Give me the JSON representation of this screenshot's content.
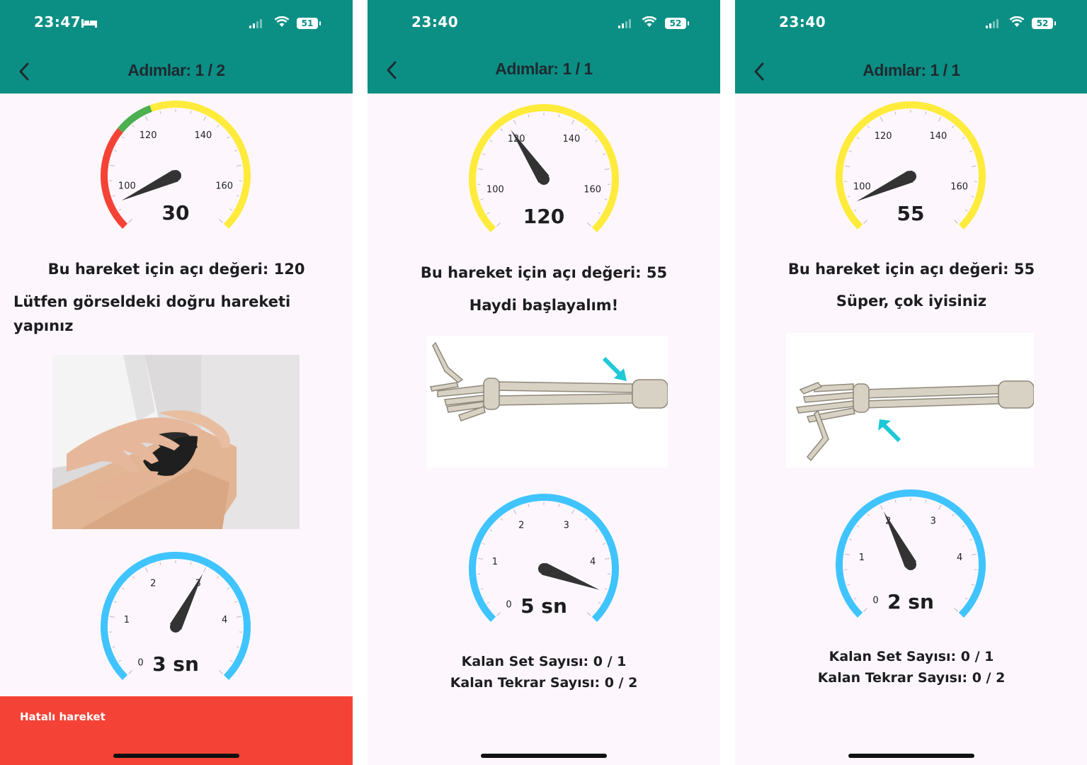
{
  "colors": {
    "header": "#0b8f85",
    "gauge_yellow": "#ffeb3b",
    "gauge_red": "#f44336",
    "gauge_green": "#4caf50",
    "timer_blue": "#40c4ff",
    "needle": "#333333",
    "toast": "#f44336"
  },
  "angle_gauge": {
    "min": 90,
    "max": 170,
    "labels": [
      "100",
      "120",
      "140",
      "160"
    ]
  },
  "timer_gauge": {
    "min": 0,
    "max": 5,
    "labels": [
      "0",
      "1",
      "2",
      "3",
      "4"
    ]
  },
  "screens": [
    {
      "status": {
        "time": "23:47",
        "battery": "51",
        "sleep_icon": "bed-icon"
      },
      "header": {
        "back_icon": "chevron-left-icon",
        "title": "Adımlar: 1 / 2"
      },
      "angle": {
        "value_label": "30",
        "needle_value": 96,
        "zones": [
          [
            "red",
            90,
            115
          ],
          [
            "green",
            115,
            124
          ],
          [
            "yellow",
            124,
            170
          ]
        ]
      },
      "angle_text": "Bu hareket için açı değeri: 120",
      "message": "Lütfen görseldeki doğru hareketi yapınız",
      "image": "knee-photo",
      "timer": {
        "value_label": "3 sn",
        "needle_value": 3
      },
      "toast": "Hatalı hareket"
    },
    {
      "status": {
        "time": "23:40",
        "battery": "52"
      },
      "header": {
        "back_icon": "chevron-left-icon",
        "title": "Adımlar: 1 / 1"
      },
      "angle": {
        "value_label": "120",
        "needle_value": 120,
        "zones": [
          [
            "yellow",
            90,
            170
          ]
        ]
      },
      "angle_text": "Bu hareket için açı değeri: 55",
      "message": "Haydi başlayalım!",
      "image": "forearm-bones-extended",
      "timer": {
        "value_label": "5 sn",
        "needle_value": 4.55
      },
      "set_count": "Kalan Set Sayısı: 0 / 1",
      "rep_count": "Kalan Tekrar Sayısı: 0 / 2"
    },
    {
      "status": {
        "time": "23:40",
        "battery": "52"
      },
      "header": {
        "back_icon": "chevron-left-icon",
        "title": "Adımlar: 1 / 1"
      },
      "angle": {
        "value_label": "55",
        "needle_value": 96,
        "zones": [
          [
            "yellow",
            90,
            170
          ]
        ]
      },
      "angle_text": "Bu hareket için açı değeri: 55",
      "message": "Süper, çok iyisiniz",
      "image": "forearm-bones-flexed",
      "timer": {
        "value_label": "2 sn",
        "needle_value": 2
      },
      "set_count": "Kalan Set Sayısı: 0 / 1",
      "rep_count": "Kalan Tekrar Sayısı: 0 / 2"
    }
  ]
}
